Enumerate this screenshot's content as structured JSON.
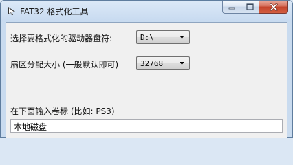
{
  "window": {
    "title": "FAT32 格式化工具-"
  },
  "drive": {
    "label": "选择要格式化的驱动器盘符:",
    "value": "D:\\"
  },
  "cluster": {
    "label": "扇区分配大小 (一般默认即可)",
    "value": "32768"
  },
  "volume": {
    "label": "在下面输入卷标 (比如: PS3)",
    "value": "本地磁盘"
  },
  "icons": {
    "app": "app-window-icon",
    "minimize": "minimize-icon",
    "maximize": "maximize-icon",
    "close": "close-icon",
    "dropdown": "chevron-down-icon"
  }
}
